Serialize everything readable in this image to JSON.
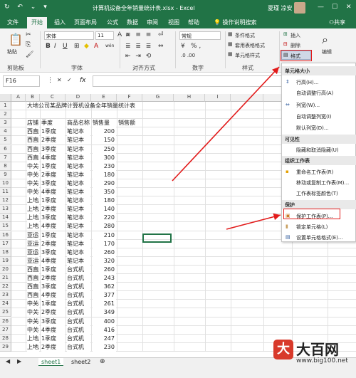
{
  "titlebar": {
    "quick_access": "↻ ↶ ⌄ ▾",
    "title": "计算机设备全年销量统计表.xlsx - Excel",
    "user": "夏瑾 凉安",
    "min": "—",
    "max": "☐",
    "close": "✕"
  },
  "tabs": [
    "文件",
    "开始",
    "插入",
    "页面布局",
    "公式",
    "数据",
    "审阅",
    "视图",
    "帮助",
    "操作说明搜索"
  ],
  "share": "共享",
  "ribbon": {
    "clipboard": "剪贴板",
    "paste": "粘贴",
    "font_name": "宋体",
    "font_size": "11",
    "font_group": "字体",
    "bold": "B",
    "italic": "I",
    "underline": "U",
    "bigA": "A",
    "smallA": "A",
    "wen": "wén",
    "align_group": "对齐方式",
    "number_format": "常规",
    "number_group": "数字",
    "pct": "% ,",
    "cond_format": "条件格式",
    "table_format": "套用表格格式",
    "cell_style": "单元格样式",
    "style_group": "样式",
    "insert": "插入",
    "delete": "删除",
    "format": "格式",
    "edit": "编辑"
  },
  "formula_bar": {
    "name_box": "F16",
    "fx": "fx"
  },
  "columns": [
    "A",
    "B",
    "C",
    "D",
    "E",
    "F",
    "G",
    "H",
    "I"
  ],
  "rows": [
    {
      "n": "1",
      "a": "大地公司某品牌计算机设备全年销量统计表"
    },
    {
      "n": "2"
    },
    {
      "n": "3",
      "a": "店铺",
      "b": "季度",
      "c": "商品名称",
      "d": "销售量",
      "e": "销售额"
    },
    {
      "n": "4",
      "a": "西直门店",
      "b": "1季度",
      "c": "笔记本",
      "d": "200"
    },
    {
      "n": "5",
      "a": "西直门店",
      "b": "2季度",
      "c": "笔记本",
      "d": "150"
    },
    {
      "n": "6",
      "a": "西直门店",
      "b": "3季度",
      "c": "笔记本",
      "d": "250"
    },
    {
      "n": "7",
      "a": "西直门店",
      "b": "4季度",
      "c": "笔记本",
      "d": "300"
    },
    {
      "n": "8",
      "a": "中关村店",
      "b": "1季度",
      "c": "笔记本",
      "d": "230"
    },
    {
      "n": "9",
      "a": "中关村店",
      "b": "2季度",
      "c": "笔记本",
      "d": "180"
    },
    {
      "n": "10",
      "a": "中关村店",
      "b": "3季度",
      "c": "笔记本",
      "d": "290"
    },
    {
      "n": "11",
      "a": "中关村店",
      "b": "4季度",
      "c": "笔记本",
      "d": "350"
    },
    {
      "n": "12",
      "a": "上地店",
      "b": "1季度",
      "c": "笔记本",
      "d": "180"
    },
    {
      "n": "13",
      "a": "上地店",
      "b": "2季度",
      "c": "笔记本",
      "d": "140"
    },
    {
      "n": "14",
      "a": "上地店",
      "b": "3季度",
      "c": "笔记本",
      "d": "220"
    },
    {
      "n": "15",
      "a": "上地店",
      "b": "4季度",
      "c": "笔记本",
      "d": "280"
    },
    {
      "n": "16",
      "a": "亚运村店",
      "b": "1季度",
      "c": "笔记本",
      "d": "210"
    },
    {
      "n": "17",
      "a": "亚运村店",
      "b": "2季度",
      "c": "笔记本",
      "d": "170"
    },
    {
      "n": "18",
      "a": "亚运村店",
      "b": "3季度",
      "c": "笔记本",
      "d": "260"
    },
    {
      "n": "19",
      "a": "亚运村店",
      "b": "4季度",
      "c": "笔记本",
      "d": "320"
    },
    {
      "n": "20",
      "a": "西直门店",
      "b": "1季度",
      "c": "台式机",
      "d": "260"
    },
    {
      "n": "21",
      "a": "西直门店",
      "b": "2季度",
      "c": "台式机",
      "d": "243"
    },
    {
      "n": "22",
      "a": "西直门店",
      "b": "3季度",
      "c": "台式机",
      "d": "362"
    },
    {
      "n": "23",
      "a": "西直门店",
      "b": "4季度",
      "c": "台式机",
      "d": "377"
    },
    {
      "n": "24",
      "a": "中关村店",
      "b": "1季度",
      "c": "台式机",
      "d": "261"
    },
    {
      "n": "25",
      "a": "中关村店",
      "b": "2季度",
      "c": "台式机",
      "d": "349"
    },
    {
      "n": "26",
      "a": "中关村店",
      "b": "3季度",
      "c": "台式机",
      "d": "400"
    },
    {
      "n": "27",
      "a": "中关村店",
      "b": "4季度",
      "c": "台式机",
      "d": "416"
    },
    {
      "n": "28",
      "a": "上地店",
      "b": "1季度",
      "c": "台式机",
      "d": "247"
    },
    {
      "n": "29",
      "a": "上地店",
      "b": "2季度",
      "c": "台式机",
      "d": "230"
    }
  ],
  "sheets": [
    "sheet1",
    "sheet2"
  ],
  "menu": {
    "h_cellsize": "单元格大小",
    "row_height": "行高(H)...",
    "autofit_row": "自动调整行高(A)",
    "col_width": "列宽(W)...",
    "autofit_col": "自动调整列宽(I)",
    "default_width": "默认列宽(D)...",
    "h_visibility": "可见性",
    "hide_unhide": "隐藏和取消隐藏(U)",
    "h_organize": "组织工作表",
    "rename": "重命名工作表(R)",
    "move_copy": "移动或复制工作表(M)...",
    "tab_color": "工作表标签颜色(T)",
    "h_protect": "保护",
    "protect_sheet": "保护工作表(P)...",
    "lock_cell": "锁定单元格(L)",
    "format_cells": "设置单元格格式(E)..."
  },
  "watermark": {
    "name": "大百网",
    "url": "www.big100.net"
  },
  "colors": {
    "excel_green": "#217346",
    "arrow_red": "#e21b1b"
  }
}
